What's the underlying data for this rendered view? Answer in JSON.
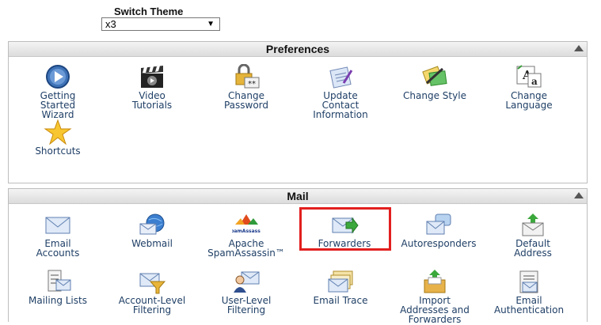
{
  "theme": {
    "label": "Switch Theme",
    "value": "x3"
  },
  "preferences": {
    "title": "Preferences",
    "items": [
      {
        "label": "Getting\nStarted\nWizard",
        "icon": "play-icon"
      },
      {
        "label": "Video\nTutorials",
        "icon": "clapperboard-icon"
      },
      {
        "label": "Change\nPassword",
        "icon": "lock-icon"
      },
      {
        "label": "Update\nContact\nInformation",
        "icon": "contact-icon"
      },
      {
        "label": "Change Style",
        "icon": "palette-icon"
      },
      {
        "label": "Change\nLanguage",
        "icon": "language-icon"
      },
      {
        "label": "Shortcuts",
        "icon": "star-icon"
      }
    ]
  },
  "mail": {
    "title": "Mail",
    "items": [
      {
        "label": "Email\nAccounts",
        "icon": "envelope-icon"
      },
      {
        "label": "Webmail",
        "icon": "globe-envelope-icon"
      },
      {
        "label": "Apache\nSpamAssassin™",
        "icon": "spamassassin-icon",
        "logo_text": "SpamAssassin"
      },
      {
        "label": "Forwarders",
        "icon": "forward-envelope-icon"
      },
      {
        "label": "Autoresponders",
        "icon": "autoresponder-icon"
      },
      {
        "label": "Default\nAddress",
        "icon": "default-address-icon"
      },
      {
        "label": "Mailing Lists",
        "icon": "mailing-list-icon"
      },
      {
        "label": "Account-Level\nFiltering",
        "icon": "filter-icon"
      },
      {
        "label": "User-Level\nFiltering",
        "icon": "user-filter-icon"
      },
      {
        "label": "Email Trace",
        "icon": "trace-icon"
      },
      {
        "label": "Import\nAddresses and\nForwarders",
        "icon": "import-icon"
      },
      {
        "label": "Email\nAuthentication",
        "icon": "authentication-icon"
      }
    ]
  },
  "colors": {
    "highlight": "#e21f1f",
    "link": "#1f3f66"
  }
}
